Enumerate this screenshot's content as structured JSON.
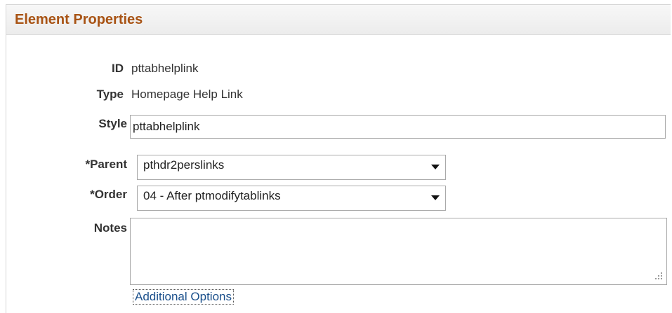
{
  "panel": {
    "title": "Element Properties"
  },
  "fields": {
    "id": {
      "label": "ID",
      "value": "pttabhelplink"
    },
    "type": {
      "label": "Type",
      "value": "Homepage Help Link"
    },
    "style": {
      "label": "Style",
      "value": "pttabhelplink"
    },
    "parent": {
      "label": "*Parent",
      "value": "pthdr2perslinks"
    },
    "order": {
      "label": "*Order",
      "value": "04 - After ptmodifytablinks"
    },
    "notes": {
      "label": "Notes",
      "value": ""
    }
  },
  "links": {
    "additional_options": "Additional Options"
  },
  "colors": {
    "title": "#a85314",
    "link": "#1a4f8b",
    "border": "#a9a9a9"
  },
  "icons": {
    "dropdown": "chevron-down-icon",
    "resize": "resize-grip-icon"
  }
}
